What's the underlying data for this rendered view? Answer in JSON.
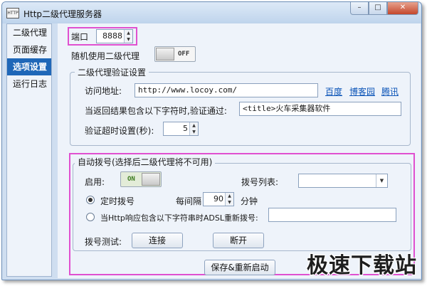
{
  "window": {
    "title": "Http二级代理服务器",
    "icon_text": "HTTP"
  },
  "window_controls": {
    "minimize": "–",
    "maximize": "□",
    "close": "✕"
  },
  "sidebar": {
    "items": [
      {
        "label": "二级代理",
        "active": false
      },
      {
        "label": "页面缓存",
        "active": false
      },
      {
        "label": "选项设置",
        "active": true
      },
      {
        "label": "运行日志",
        "active": false
      }
    ]
  },
  "port": {
    "label": "端口",
    "value": "8888"
  },
  "random_proxy": {
    "label": "随机使用二级代理",
    "toggle_text": "OFF",
    "state": "off"
  },
  "verify": {
    "group_title": "二级代理验证设置",
    "url_label": "访问地址:",
    "url_value": "http://www.locoy.com/",
    "links": [
      "百度",
      "博客园",
      "腾讯"
    ],
    "match_label": "当返回结果包含以下字符时,验证通过:",
    "match_value": "<title>火车采集器软件",
    "timeout_label": "验证超时设置(秒):",
    "timeout_value": "5"
  },
  "dial": {
    "group_title": "自动拨号(选择后二级代理将不可用)",
    "enable_label": "启用:",
    "enable_toggle_text": "ON",
    "enable_state": "on",
    "dial_list_label": "拨号列表:",
    "dial_list_value": "",
    "timed_label": "定时拨号",
    "timed_checked": true,
    "interval_label": "每间隔",
    "interval_value": "90",
    "interval_unit": "分钟",
    "http_label": "当Http响应包含以下字符串时ADSL重新拨号:",
    "http_checked": false,
    "http_value": "",
    "test_label": "拨号测试:",
    "connect_label": "连接",
    "disconnect_label": "断开"
  },
  "footer": {
    "save_restart_label": "保存&重新启动"
  },
  "watermark": {
    "text": "极速下载站"
  },
  "colors": {
    "accent": "#1f67b8",
    "highlight": "#e050d0",
    "link": "#0c55b8"
  }
}
